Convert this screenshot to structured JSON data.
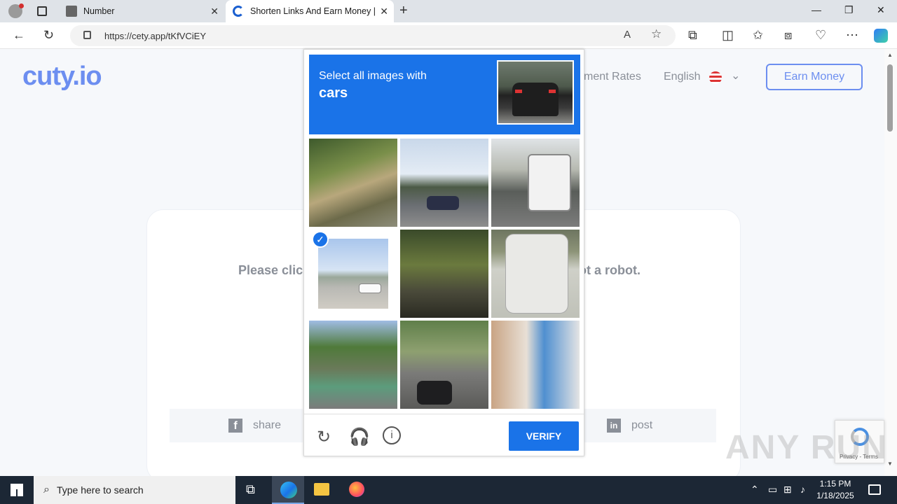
{
  "browser": {
    "tabs": [
      {
        "title": "Number"
      },
      {
        "title": "Shorten Links And Earn Money |"
      }
    ],
    "url": "https://cety.app/tKfVCiEY"
  },
  "site": {
    "logo": "cuty.io",
    "nav_rates": "ment Rates",
    "language": "English",
    "earn_button": "Earn Money",
    "prompt_left": "Please clic",
    "prompt_right": "ot a robot.",
    "share_fb": "share",
    "share_li": "post"
  },
  "captcha": {
    "instruction": "Select all images with",
    "target": "cars",
    "verify_label": "VERIFY",
    "selected_tiles": [
      4
    ]
  },
  "recaptcha": {
    "links": "Privacy - Terms"
  },
  "watermark": "ANY RUN",
  "taskbar": {
    "search_placeholder": "Type here to search",
    "time": "1:15 PM",
    "date": "1/18/2025"
  },
  "colors": {
    "accent": "#1a73e8",
    "brand": "#6c8ef0"
  }
}
